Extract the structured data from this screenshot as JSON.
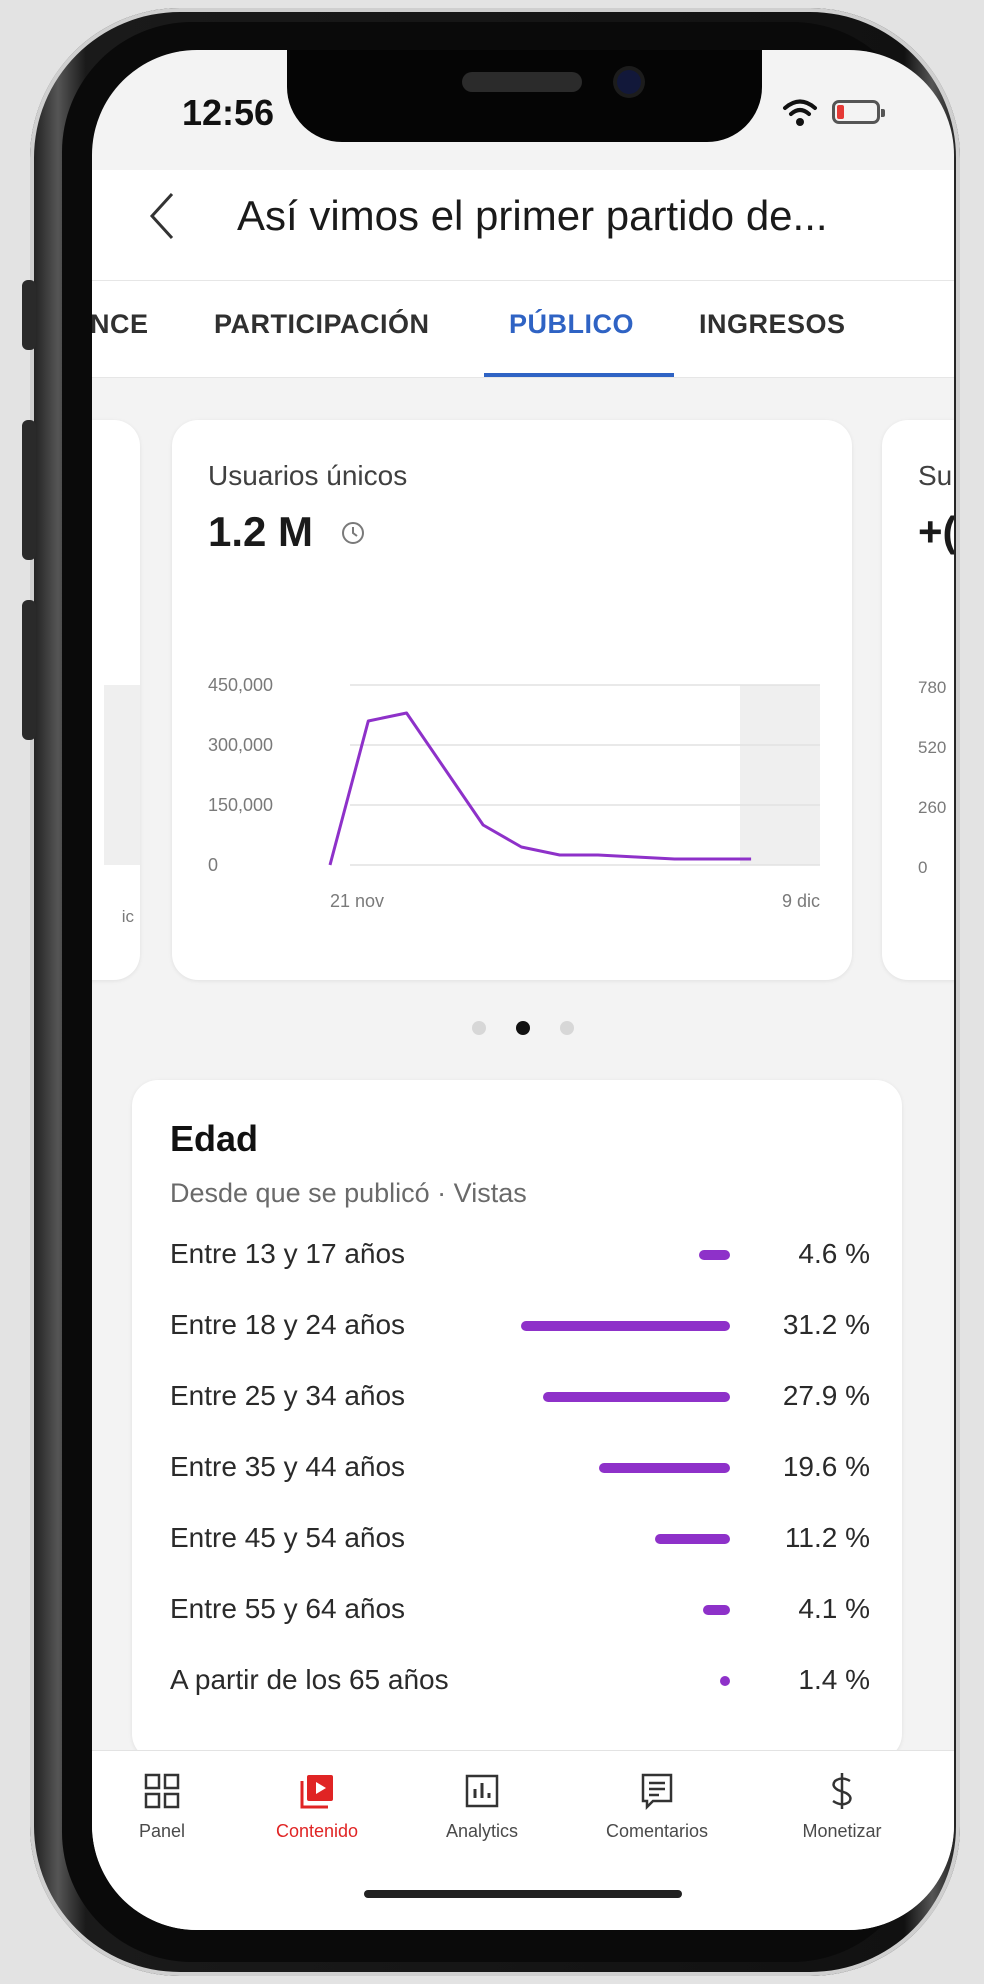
{
  "status_bar": {
    "time": "12:56"
  },
  "header": {
    "title": "Así vimos el primer partido de..."
  },
  "tabs": [
    {
      "label": "NCE"
    },
    {
      "label": "PARTICIPACIÓN"
    },
    {
      "label": "PÚBLICO",
      "active": true
    },
    {
      "label": "INGRESOS"
    }
  ],
  "metric_card": {
    "label": "Usuarios únicos",
    "value": "1.2 M",
    "y_ticks": [
      "450,000",
      "300,000",
      "150,000",
      "0"
    ],
    "x_start": "21 nov",
    "x_end": "9 dic"
  },
  "chart_data": {
    "type": "line",
    "title": "Usuarios únicos",
    "x": [
      0,
      1,
      2,
      3,
      4,
      5,
      6,
      7,
      8,
      9,
      10,
      11
    ],
    "x_tick_labels": [
      "21 nov",
      "9 dic"
    ],
    "series": [
      {
        "values": [
          0,
          360000,
          380000,
          240000,
          100000,
          45000,
          25000,
          25000,
          20000,
          15000,
          15000,
          15000
        ]
      }
    ],
    "ylim": [
      0,
      450000
    ],
    "y_ticks": [
      0,
      150000,
      300000,
      450000
    ],
    "grid": true,
    "color": "#8e31c9"
  },
  "right_card_peek": {
    "label": "Su",
    "value": "+(",
    "ticks": [
      "780",
      "520",
      "260",
      "0"
    ]
  },
  "left_card_peek": {
    "tick": "ic"
  },
  "age": {
    "title": "Edad",
    "subtitle": "Desde que se publicó · Vistas",
    "rows": [
      {
        "label": "Entre 13 y 17 años",
        "percent": "4.6 %",
        "value": 4.6
      },
      {
        "label": "Entre 18 y 24 años",
        "percent": "31.2 %",
        "value": 31.2
      },
      {
        "label": "Entre 25 y 34 años",
        "percent": "27.9 %",
        "value": 27.9
      },
      {
        "label": "Entre 35 y 44 años",
        "percent": "19.6 %",
        "value": 19.6
      },
      {
        "label": "Entre 45 y 54 años",
        "percent": "11.2 %",
        "value": 11.2
      },
      {
        "label": "Entre 55 y 64 años",
        "percent": "4.1 %",
        "value": 4.1
      },
      {
        "label": "A partir de los 65 años",
        "percent": "1.4 %",
        "value": 1.4
      }
    ]
  },
  "nav": {
    "items": [
      {
        "label": "Panel",
        "icon": "dashboard-icon"
      },
      {
        "label": "Contenido",
        "icon": "content-icon",
        "active": true
      },
      {
        "label": "Analytics",
        "icon": "analytics-icon"
      },
      {
        "label": "Comentarios",
        "icon": "comments-icon"
      },
      {
        "label": "Monetizar",
        "icon": "dollar-icon"
      }
    ]
  },
  "colors": {
    "accent": "#2f63c4",
    "bar": "#8e31c9",
    "active_nav": "#e02424"
  }
}
